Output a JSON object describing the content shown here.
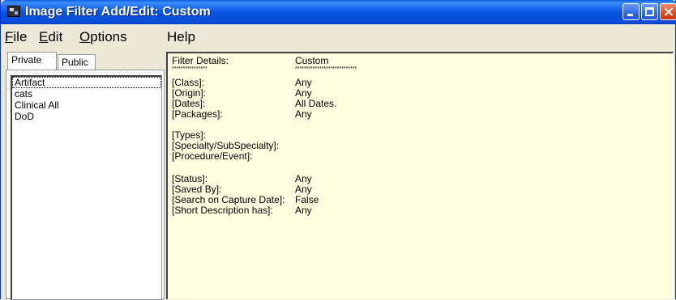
{
  "window": {
    "title": "Image Filter Add/Edit: Custom",
    "app_icon": "film-camera-icon",
    "controls": {
      "minimize": "minimize-icon",
      "maximize": "maximize-icon",
      "close": "close-icon"
    }
  },
  "menu": [
    {
      "label": "File",
      "accel": "F",
      "rest": "ile"
    },
    {
      "label": "Edit",
      "accel": "E",
      "rest": "dit"
    },
    {
      "label": "Options",
      "accel": "O",
      "rest": "ptions"
    },
    {
      "label": "Help",
      "accel": "",
      "rest": "Help"
    }
  ],
  "tabs": {
    "private": "Private",
    "public": "Public",
    "active": "Private"
  },
  "filters": [
    "Artifact",
    "cats",
    "Clinical All",
    "DoD"
  ],
  "details": {
    "header_label": "Filter Details:",
    "header_value": "Custom",
    "header_label_stars": "****************",
    "header_value_stars": "****************************",
    "rows": [
      {
        "label": "[Class]:",
        "value": "Any"
      },
      {
        "label": "[Origin]:",
        "value": "Any"
      },
      {
        "label": "[Dates]:",
        "value": "All Dates."
      },
      {
        "label": "[Packages]:",
        "value": "Any"
      },
      {
        "label": "[Types]:",
        "value": ""
      },
      {
        "label": "[Specialty/SubSpecialty]:",
        "value": ""
      },
      {
        "label": "[Procedure/Event]:",
        "value": ""
      },
      {
        "label": "[Status]:",
        "value": "Any"
      },
      {
        "label": "[Saved By]:",
        "value": "Any"
      },
      {
        "label": "[Search on Capture Date]:",
        "value": "False"
      },
      {
        "label": "[Short Description has]:",
        "value": "Any"
      }
    ]
  }
}
